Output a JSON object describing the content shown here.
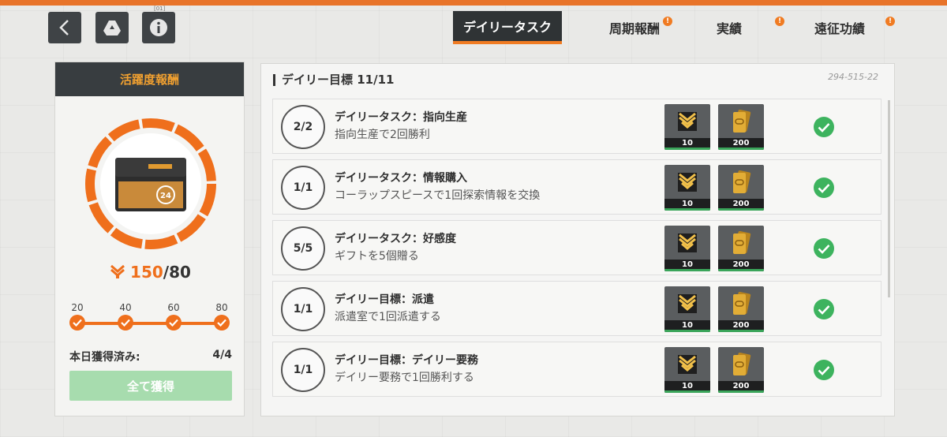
{
  "nav": {
    "info_badge": "[01]"
  },
  "tabs": [
    {
      "label": "デイリータスク",
      "active": true,
      "alert": false
    },
    {
      "label": "周期報酬",
      "active": false,
      "alert": true
    },
    {
      "label": "実績",
      "active": false,
      "alert": true
    },
    {
      "label": "遠征功績",
      "active": false,
      "alert": true
    }
  ],
  "alert_mark": "!",
  "left": {
    "title": "活躍度報酬",
    "chest_number": "24",
    "score_current": "150",
    "score_separator": "/",
    "score_target": "80",
    "milestones": [
      "20",
      "40",
      "60",
      "80"
    ],
    "claimed_label": "本日獲得済み:",
    "claimed_value": "4/4",
    "claim_button": "全て獲得",
    "ring_progress": 1.0
  },
  "right": {
    "title": "デイリー目標 11/11",
    "code": "294-515-22",
    "tasks": [
      {
        "progress": "2/2",
        "title": "デイリータスク：指向生産",
        "desc": "指向生産で2回勝利",
        "reward1": "10",
        "reward2": "200"
      },
      {
        "progress": "1/1",
        "title": "デイリータスク：情報購入",
        "desc": "コーラップスピースで1回探索情報を交換",
        "reward1": "10",
        "reward2": "200"
      },
      {
        "progress": "5/5",
        "title": "デイリータスク：好感度",
        "desc": "ギフトを5個贈る",
        "reward1": "10",
        "reward2": "200"
      },
      {
        "progress": "1/1",
        "title": "デイリー目標：派遣",
        "desc": "派遣室で1回派遣する",
        "reward1": "10",
        "reward2": "200"
      },
      {
        "progress": "1/1",
        "title": "デイリー目標：デイリー要務",
        "desc": "デイリー要務で1回勝利する",
        "reward1": "10",
        "reward2": "200"
      }
    ]
  },
  "colors": {
    "accent": "#ef6f1c",
    "dark": "#383d40",
    "success": "#3db35e",
    "claim_button": "#a7dcae"
  },
  "icons": {
    "back": "chevron-left-icon",
    "drive": "triangle-logo-icon",
    "info": "info-icon",
    "activity": "chevron-stack-icon",
    "check": "check-icon",
    "reward_gold": "gold-bar-icon"
  }
}
